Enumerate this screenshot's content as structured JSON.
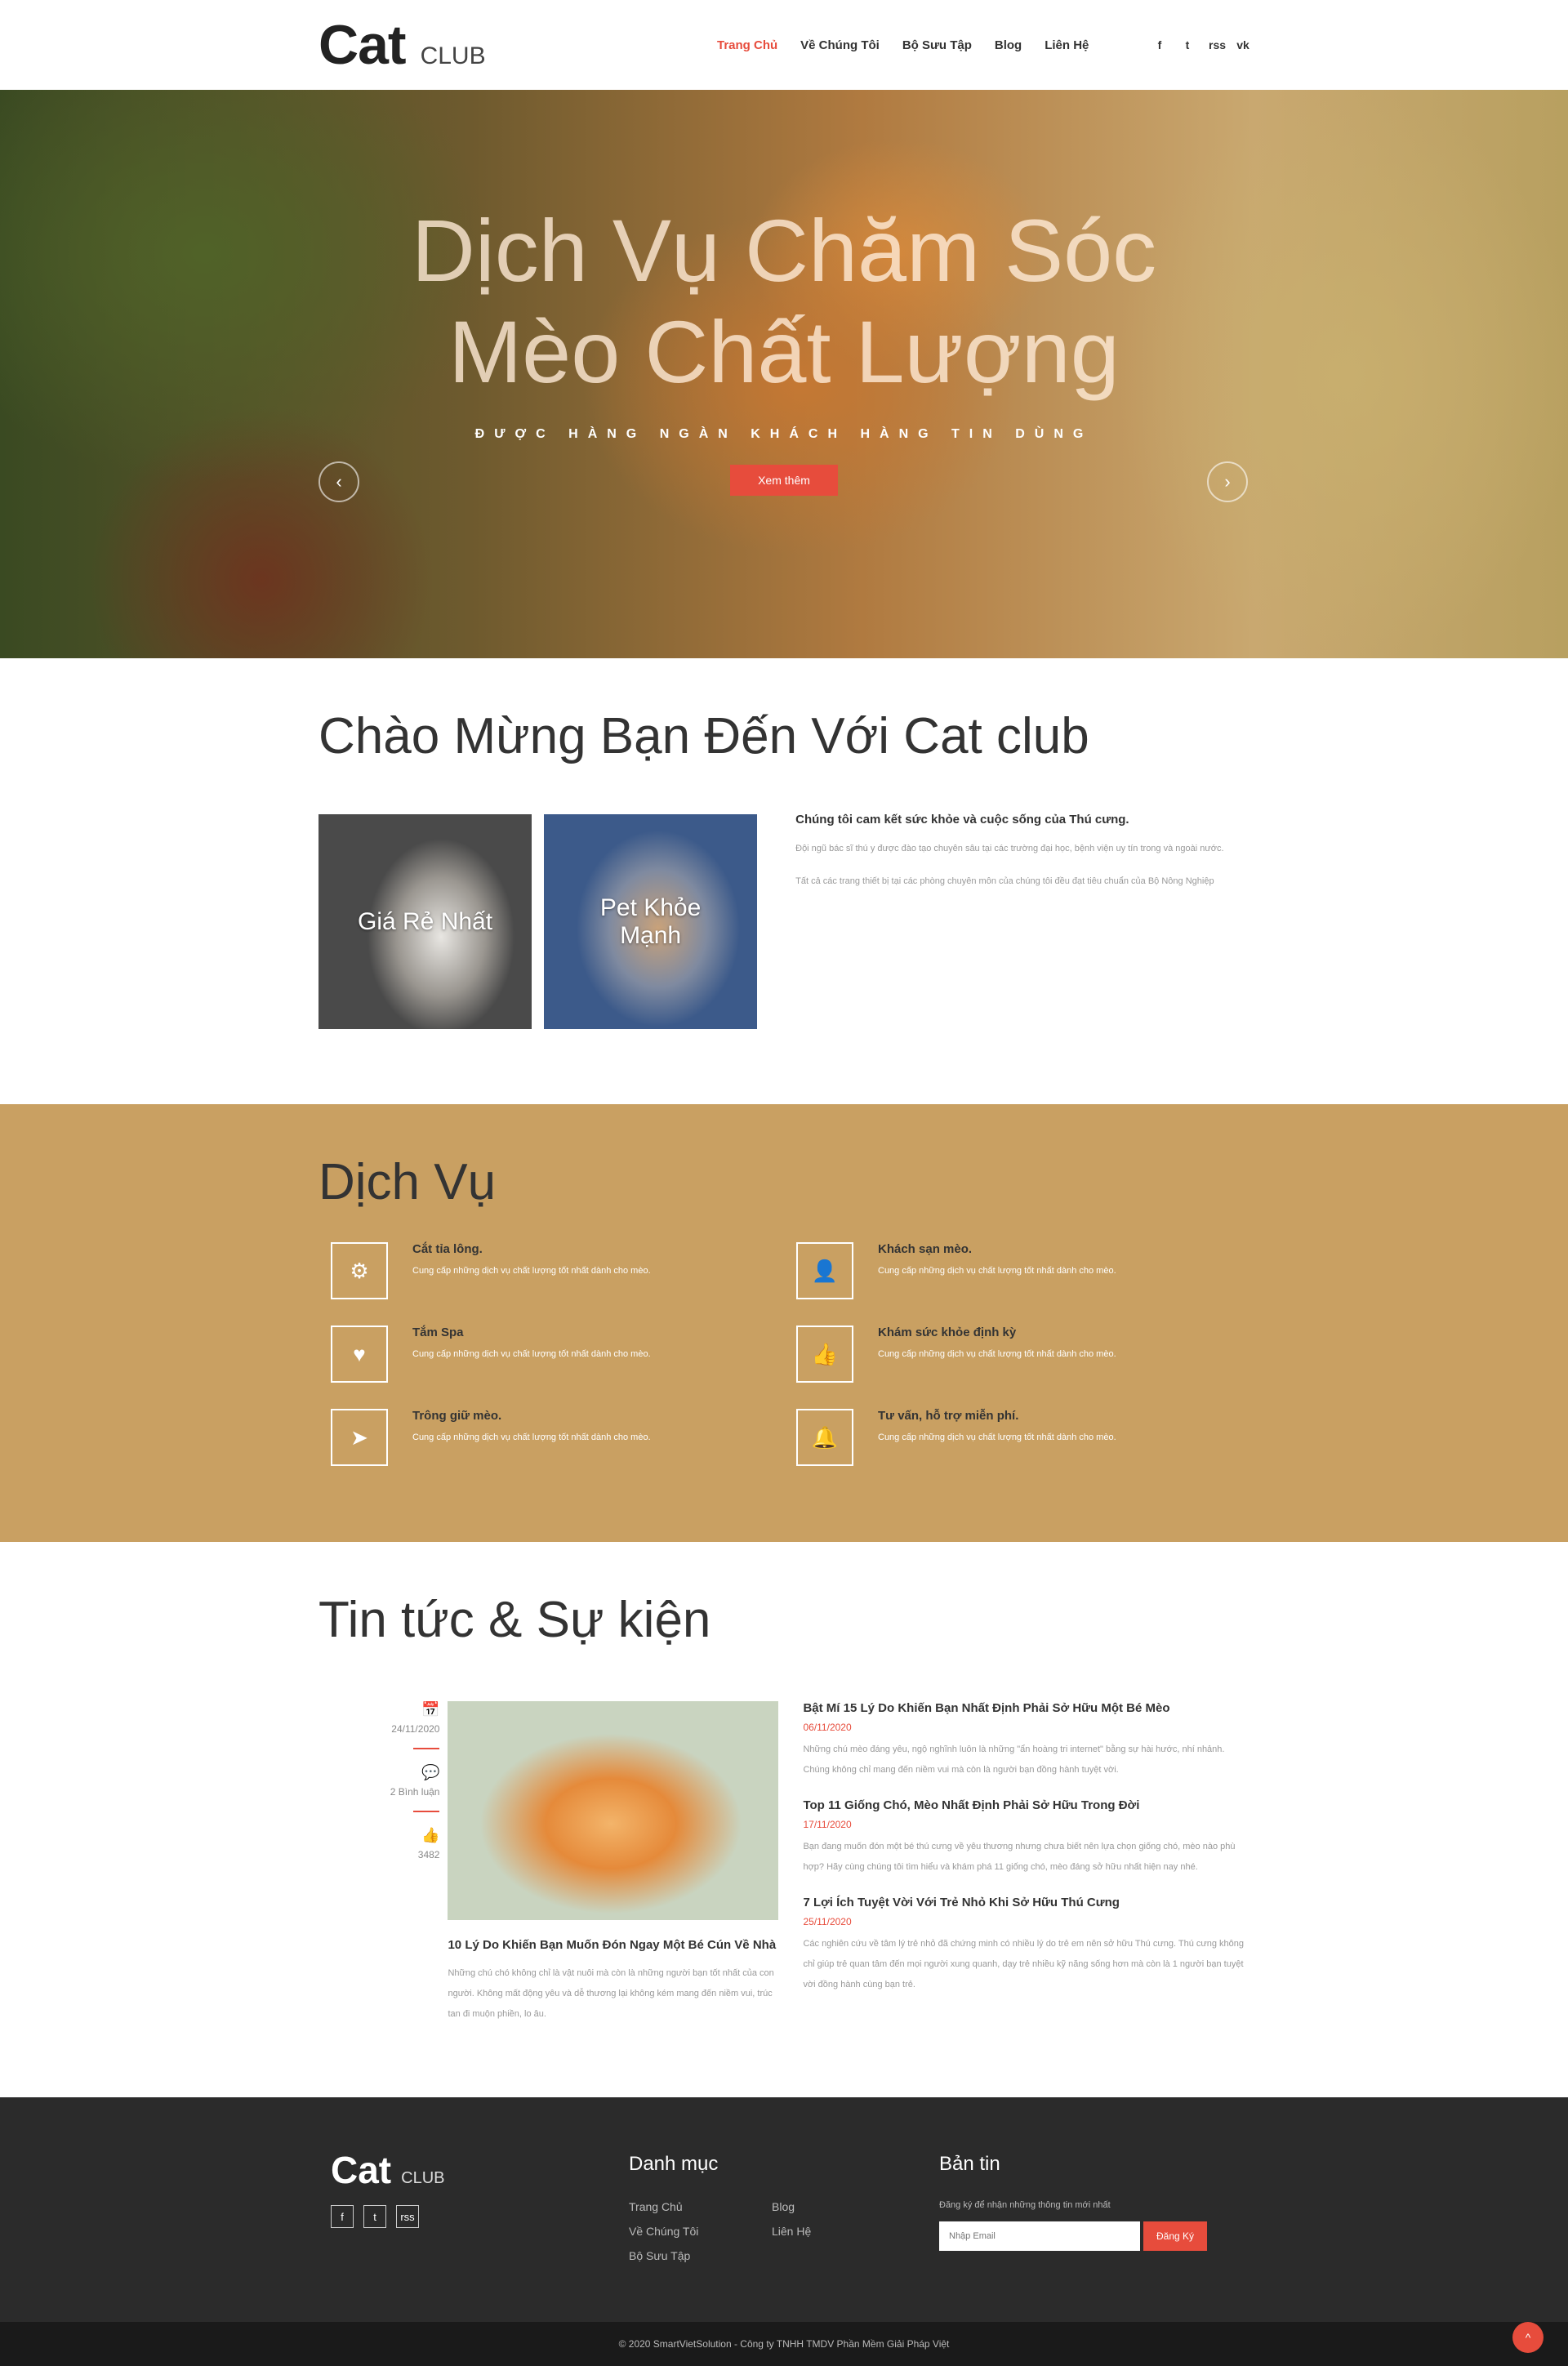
{
  "header": {
    "logo_main": "Cat",
    "logo_sub": "CLUB",
    "nav": [
      "Trang Chủ",
      "Về Chúng Tôi",
      "Bộ Sưu Tập",
      "Blog",
      "Liên Hệ"
    ],
    "socials": [
      "f",
      "t",
      "rss",
      "vk"
    ]
  },
  "hero": {
    "title_line1": "Dịch Vụ Chăm Sóc",
    "title_line2": "Mèo Chất Lượng",
    "subtitle": "ĐƯỢC HÀNG NGÀN KHÁCH HÀNG TIN DÙNG",
    "button": "Xem thêm",
    "prev": "‹",
    "next": "›"
  },
  "welcome": {
    "title": "Chào Mừng Bạn Đến Với Cat club",
    "card1": "Giá Rẻ Nhất",
    "card2": "Pet Khỏe Mạnh",
    "heading": "Chúng tôi cam kết sức khỏe và cuộc sống của Thú cưng.",
    "para1": "Đội ngũ bác sĩ thú y được đào tạo chuyên sâu tại các trường đại học, bệnh viện uy tín trong và ngoài nước.",
    "para2": "Tất cả các trang thiết bị tại các phòng chuyên môn của chúng tôi đều đạt tiêu chuẩn của Bộ Nông Nghiệp"
  },
  "services": {
    "title": "Dịch Vụ",
    "items": [
      {
        "icon": "gear-icon",
        "glyph": "⚙",
        "name": "Cắt tỉa lông.",
        "desc": "Cung cấp những dịch vụ chất lượng tốt nhất dành cho mèo."
      },
      {
        "icon": "user-icon",
        "glyph": "👤",
        "name": "Khách sạn mèo.",
        "desc": "Cung cấp những dịch vụ chất lượng tốt nhất dành cho mèo."
      },
      {
        "icon": "heart-icon",
        "glyph": "♥",
        "name": "Tắm Spa",
        "desc": "Cung cấp những dịch vụ chất lượng tốt nhất dành cho mèo."
      },
      {
        "icon": "thumbs-up-icon",
        "glyph": "👍",
        "name": "Khám sức khỏe định kỳ",
        "desc": "Cung cấp những dịch vụ chất lượng tốt nhất dành cho mèo."
      },
      {
        "icon": "paper-plane-icon",
        "glyph": "➤",
        "name": "Trông giữ mèo.",
        "desc": "Cung cấp những dịch vụ chất lượng tốt nhất dành cho mèo."
      },
      {
        "icon": "bell-icon",
        "glyph": "🔔",
        "name": "Tư vấn, hỗ trợ miễn phí.",
        "desc": "Cung cấp những dịch vụ chất lượng tốt nhất dành cho mèo."
      }
    ]
  },
  "news": {
    "title": "Tin tức & Sự kiện",
    "meta": [
      {
        "glyph": "📅",
        "text": "24/11/2020"
      },
      {
        "glyph": "💬",
        "text": "2 Bình luận"
      },
      {
        "glyph": "👍",
        "text": "3482"
      }
    ],
    "featured_title": "10 Lý Do Khiến Bạn Muốn Đón Ngay Một Bé Cún Về Nhà",
    "featured_desc": "Những chú chó không chỉ là vật nuôi mà còn là những người bạn tốt nhất của con người. Không mất động yêu và dễ thương lại không kém mang đến niềm vui, trúc tan đi muộn phiền, lo âu.",
    "items": [
      {
        "title": "Bật Mí 15 Lý Do Khiến Bạn Nhất Định Phải Sở Hữu Một Bé Mèo",
        "date": "06/11/2020",
        "desc": "Những chú mèo đáng yêu, ngộ nghĩnh luôn là những \"ẩn hoàng tri internet\" bằng sự hài hước, nhí nhảnh. Chúng không chỉ mang đến niềm vui mà còn là người bạn đồng hành tuyệt vời."
      },
      {
        "title": "Top 11 Giống Chó, Mèo Nhất Định Phải Sở Hữu Trong Đời",
        "date": "17/11/2020",
        "desc": "Bạn đang muốn đón một bé thú cưng về yêu thương nhưng chưa biết nên lựa chọn giống chó, mèo nào phù hợp? Hãy cùng chúng tôi tìm hiểu và khám phá 11 giống chó, mèo đáng sở hữu nhất hiện nay nhé."
      },
      {
        "title": "7 Lợi Ích Tuyệt Vời Với Trẻ Nhỏ Khi Sở Hữu Thú Cưng",
        "date": "25/11/2020",
        "desc": "Các nghiên cứu về tâm lý trẻ nhỏ đã chứng minh có nhiều lý do trẻ em nên sở hữu Thú cưng. Thú cưng không chỉ giúp trẻ quan tâm đến mọi người xung quanh, dạy trẻ nhiều kỹ năng sống hơn mà còn là 1 người bạn tuyệt vời đồng hành cùng bạn trẻ."
      }
    ]
  },
  "footer": {
    "logo_main": "Cat",
    "logo_sub": "CLUB",
    "socials": [
      "f",
      "t",
      "rss"
    ],
    "menu_title": "Danh mục",
    "links": [
      "Trang Chủ",
      "Blog",
      "Về Chúng Tôi",
      "Liên Hệ",
      "Bộ Sưu Tập"
    ],
    "news_title": "Bản tin",
    "news_desc": "Đăng ký để nhận những thông tin mới nhất",
    "email_placeholder": "Nhập Email",
    "subscribe": "Đăng Ký",
    "copyright": "© 2020 SmartVietSolution - Công ty TNHH TMDV Phần Mềm Giải Pháp Việt",
    "to_top": "^"
  },
  "colors": {
    "accent": "#e74c3c",
    "services_bg": "#c9a062",
    "footer_bg": "#2b2b2b"
  }
}
